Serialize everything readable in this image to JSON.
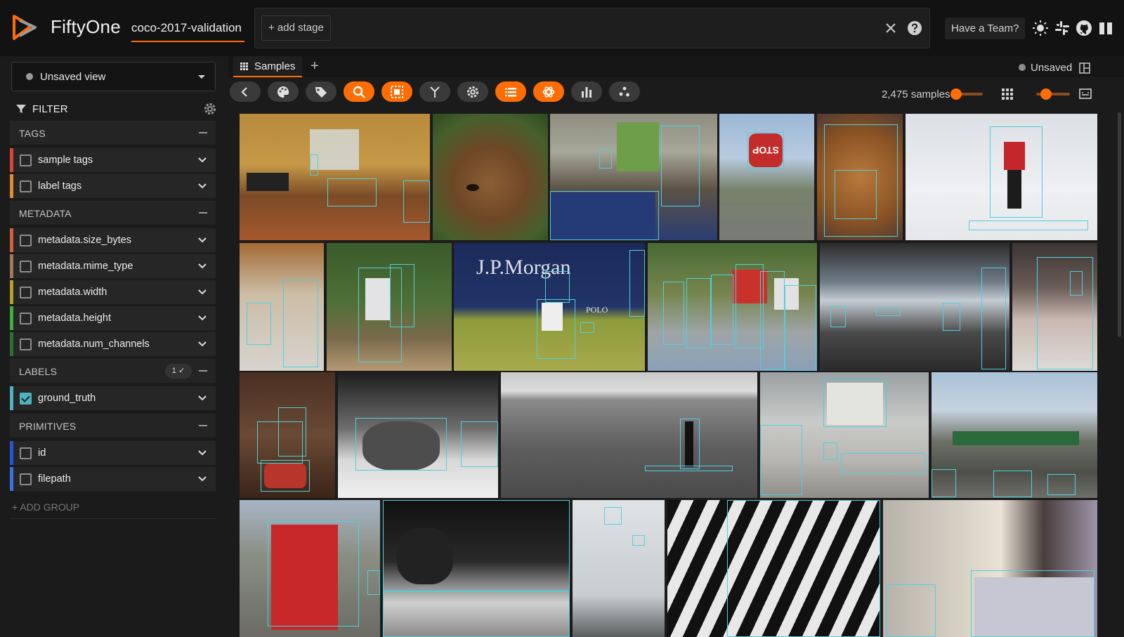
{
  "app": {
    "brand": "FiftyOne",
    "dataset": "coco-2017-validation",
    "add_stage": "+ add stage",
    "team_button": "Have a Team?"
  },
  "sidebar": {
    "view_select": "Unsaved view",
    "filter_label": "FILTER",
    "groups": {
      "tags": {
        "title": "TAGS"
      },
      "metadata": {
        "title": "METADATA"
      },
      "labels": {
        "title": "LABELS",
        "count": "1 ✓"
      },
      "primitives": {
        "title": "PRIMITIVES"
      }
    },
    "fields": {
      "sample_tags": "sample tags",
      "label_tags": "label tags",
      "size_bytes": "metadata.size_bytes",
      "mime_type": "metadata.mime_type",
      "width": "metadata.width",
      "height": "metadata.height",
      "num_channels": "metadata.num_channels",
      "ground_truth": "ground_truth",
      "id": "id",
      "filepath": "filepath"
    },
    "add_group": "+ ADD GROUP"
  },
  "main": {
    "tab_label": "Samples",
    "tab_add": "+",
    "unsaved": "Unsaved",
    "sample_count": "2,475 samples",
    "action_icons": [
      "back-icon",
      "palette-icon",
      "tag-icon",
      "search-icon",
      "selection-icon",
      "merge-icon",
      "gear-icon",
      "list-icon",
      "openai-icon",
      "histogram-icon",
      "embeddings-icon"
    ],
    "active_actions": [
      "search-icon",
      "selection-icon",
      "list-icon",
      "openai-icon"
    ],
    "image_text": {
      "stop": "STOP",
      "jpmorgan": "J.P.Morgan",
      "polo": "POLO"
    }
  },
  "colors": {
    "accent": "#ff6d04",
    "label_box": "#4fd0dc",
    "tags_bar": "#d9453a",
    "label_tags_bar": "#e38a2e",
    "metadata_bars": [
      "#d35f3d",
      "#a5775a",
      "#b6a02a",
      "#3fae3d",
      "#2e6e34"
    ],
    "ground_truth_bar": "#4fb3bf",
    "primitives_bars": [
      "#2a52d8",
      "#3c6fe6"
    ]
  }
}
